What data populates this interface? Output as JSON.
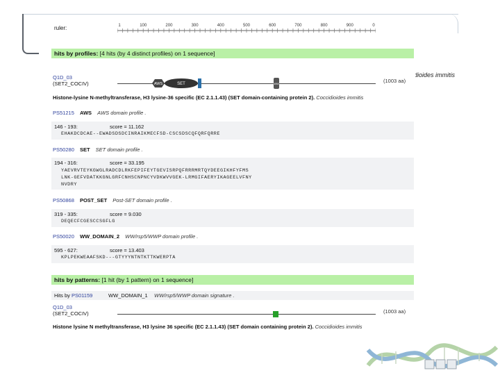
{
  "ruler": {
    "label": "ruler:",
    "ticks": [
      "1",
      "100",
      "200",
      "300",
      "400",
      "500",
      "600",
      "700",
      "800",
      "900",
      "0"
    ]
  },
  "profiles_header": {
    "bold": "hits by profiles:",
    "text": "[4 hits (by 4 distinct profiles) on 1 sequence]"
  },
  "protein": {
    "id": "Q1D_03",
    "name": "(SET2_COCIV)",
    "length": "(1003 aa)",
    "description": "Histone-lysine N-methyltransferase, H3 lysine-36 specific (EC 2.1.1.43) (SET domain-containing protein 2).",
    "organism": "Coccidioides immitis"
  },
  "domain_glyphs": {
    "aws": "AWS",
    "set": "SET",
    "post": "POST",
    "ww": "WW"
  },
  "side_organism": "dioides immitis",
  "hits": [
    {
      "accession": "PS51215",
      "name": "AWS",
      "desc": "AWS domain profile .",
      "range": "146 - 193:",
      "score": "score = 11.162",
      "seq": [
        "EHAKDCDCAE--EWADSDSDCINRAIKMECFSD-CSCSDSCQFQRFQRRE"
      ]
    },
    {
      "accession": "PS50280",
      "name": "SET",
      "desc": "SET domain profile .",
      "range": "194 - 316:",
      "score": "score = 33.195",
      "seq": [
        "YAEVRVTEYKGWGLRADCDLRKFEPIFEYTGEVISRPQFRRRMRTQYDEEGIKHFYFMS",
        "LNK-GEFVDATKKGNLGRFCNHSCNPNCYVDKWVVGEK-LRMGIFAERYIKAGEELVFNY",
        "NVDRY"
      ]
    },
    {
      "accession": "PS50868",
      "name": "POST_SET",
      "desc": "Post-SET domain profile .",
      "range": "319 - 335:",
      "score": "score = 9.030",
      "seq": [
        "DEQECFCGESCCSGFLG"
      ]
    },
    {
      "accession": "PS50020",
      "name": "WW_DOMAIN_2",
      "desc": "WW/rsp5/WWP domain profile .",
      "range": "595 - 627:",
      "score": "score = 13.403",
      "seq": [
        "KPLPEKWEAAFSKD---GTYYYNTNTKTTKWERPTA"
      ]
    }
  ],
  "patterns_header": {
    "bold": "hits by patterns:",
    "text": "[1 hit (by 1 pattern) on 1 sequence]"
  },
  "pattern_hit": {
    "prefix": "Hits by",
    "accession": "PS01159",
    "name": "WW_DOMAIN_1",
    "desc": "WW/rsp5/WWP domain signature ."
  },
  "protein2": {
    "id": "Q1D_03",
    "name": "(SET2_COCIV)",
    "length": "(1003 aa)",
    "description": "Histone lysine N methyltransferase, H3 lysine 36 specific (EC 2.1.1.43) (SET domain containing protein 2).",
    "organism": "Coccidioides immitis"
  },
  "colors": {
    "green_band": "#b9f0a6",
    "link": "#2c3f9b",
    "aws_glyph": "#444444",
    "set_glyph": "#333333",
    "post_glyph": "#2a6fa8",
    "ww_glyph": "#555555",
    "pattern_glyph": "#27a02a"
  }
}
